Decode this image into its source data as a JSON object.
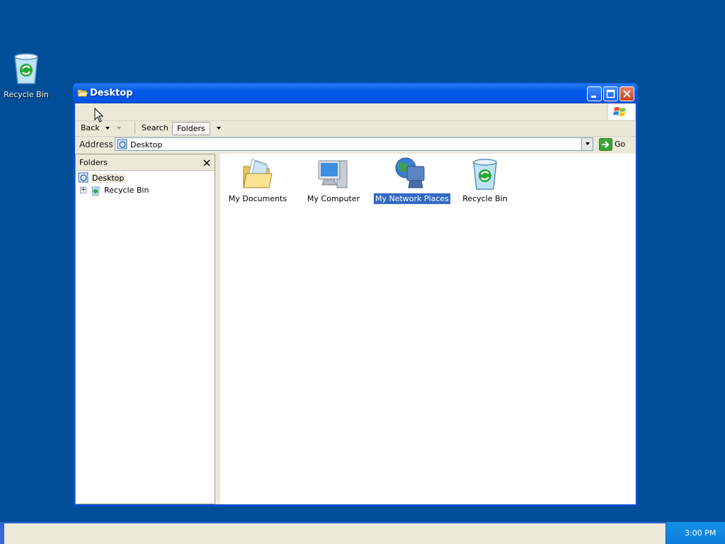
{
  "desktop": {
    "icons": [
      {
        "label": "Recycle Bin",
        "icon": "recycle-bin-icon"
      }
    ]
  },
  "window": {
    "title": "Desktop",
    "toolbar": {
      "back_label": "Back",
      "search_label": "Search",
      "folders_label": "Folders"
    },
    "address": {
      "label": "Address",
      "value": "Desktop",
      "go_label": "Go"
    },
    "folders_pane": {
      "title": "Folders",
      "tree": [
        {
          "label": "Desktop",
          "selected": true
        },
        {
          "label": "Recycle Bin",
          "expander": "+"
        }
      ]
    },
    "items": [
      {
        "label": "My Documents",
        "icon": "my-documents-icon"
      },
      {
        "label": "My Computer",
        "icon": "my-computer-icon"
      },
      {
        "label": "My Network Places",
        "icon": "my-network-places-icon",
        "selected": true
      },
      {
        "label": "Recycle Bin",
        "icon": "recycle-bin-icon"
      }
    ]
  },
  "taskbar": {
    "clock": "3:00 PM"
  },
  "colors": {
    "desktop": "#004e98",
    "titlebar": "#0058e6",
    "selection": "#316ac5",
    "chrome": "#ece9d8"
  }
}
